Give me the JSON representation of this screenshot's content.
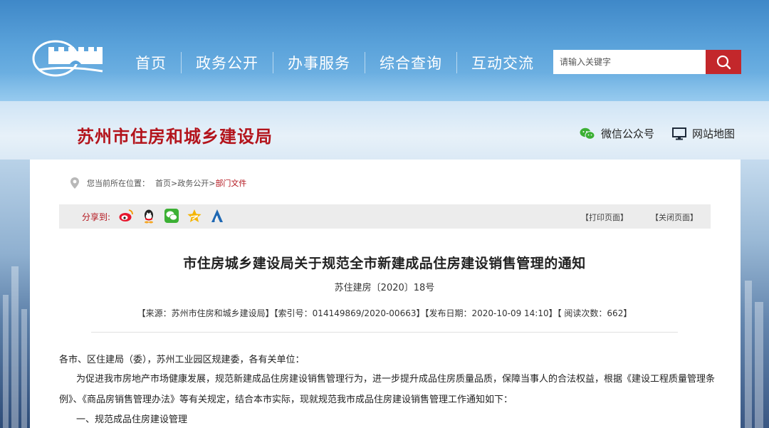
{
  "nav": {
    "items": [
      "首页",
      "政务公开",
      "办事服务",
      "综合查询",
      "互动交流"
    ]
  },
  "search": {
    "placeholder": "请输入关键字"
  },
  "header": {
    "site_title": "苏州市住房和城乡建设局",
    "wechat_label": "微信公众号",
    "sitemap_label": "网站地图"
  },
  "breadcrumb": {
    "prefix": "您当前所在位置：",
    "home": "首页",
    "sep": ">",
    "section": "政务公开",
    "current": "部门文件"
  },
  "share": {
    "label": "分享到:",
    "icons": [
      "weibo-icon",
      "qq-icon",
      "wechat-icon",
      "qzone-icon",
      "renren-icon"
    ],
    "print": "【打印页面】",
    "close": "【关闭页面】"
  },
  "article": {
    "title": "市住房城乡建设局关于规范全市新建成品住房建设销售管理的通知",
    "doc_no": "苏住建房〔2020〕18号",
    "meta": "【来源：苏州市住房和城乡建设局】【索引号：014149869/2020-00663】【发布日期：2020-10-09 14:10】【 阅读次数：662】",
    "salutation": "各市、区住建局（委），苏州工业园区规建委，各有关单位：",
    "para1_line1": "为促进我市房地产市场健康发展，规范新建成品住房建设销售管理行为，进一步提升成品住房质量品质，保障当事人的合法权益，根据《建设工程质量管理条",
    "para1_line2": "例》、《商品房销售管理办法》等有关规定，结合本市实际，现就规范我市成品住房建设销售管理工作通知如下：",
    "section1": "一、规范成品住房建设管理"
  },
  "colors": {
    "accent_red": "#b3141c",
    "search_button": "#c3272b",
    "nav_blue": "#4a93d1"
  }
}
